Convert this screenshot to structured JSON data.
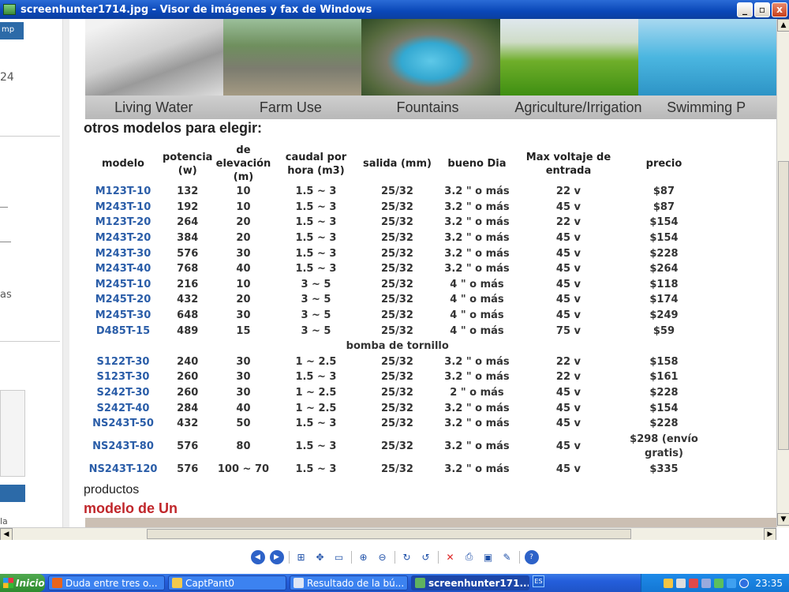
{
  "window": {
    "title": "screenhunter1714.jpg - Visor de imágenes y fax de Windows",
    "minimize": "_",
    "maximize": "▫",
    "close": "x"
  },
  "left_strip": {
    "tab_text": "mp",
    "number": "24",
    "text_as": "as",
    "text_la": "la"
  },
  "banner": {
    "captions": [
      "Living Water",
      "Farm Use",
      "Fountains",
      "Agriculture/Irrigation",
      "Swimming P"
    ]
  },
  "subtitle": "otros modelos para elegir:",
  "table": {
    "headers": [
      [
        "modelo"
      ],
      [
        "potencia",
        "(w)"
      ],
      [
        "de",
        "elevación",
        "(m)"
      ],
      [
        "caudal por",
        "hora (m3)"
      ],
      [
        "salida (mm)"
      ],
      [
        "bueno Dia"
      ],
      [
        "Max voltaje de",
        "entrada"
      ],
      [
        "precio"
      ]
    ],
    "rows": [
      [
        "M123T-10",
        "132",
        "10",
        "1.5 ~ 3",
        "25/32",
        "3.2 \" o más",
        "22 v",
        "$87"
      ],
      [
        "M243T-10",
        "192",
        "10",
        "1.5 ~ 3",
        "25/32",
        "3.2 \" o más",
        "45 v",
        "$87"
      ],
      [
        "M123T-20",
        "264",
        "20",
        "1.5 ~ 3",
        "25/32",
        "3.2 \" o más",
        "22 v",
        "$154"
      ],
      [
        "M243T-20",
        "384",
        "20",
        "1.5 ~ 3",
        "25/32",
        "3.2 \" o más",
        "45 v",
        "$154"
      ],
      [
        "M243T-30",
        "576",
        "30",
        "1.5 ~ 3",
        "25/32",
        "3.2 \" o más",
        "45 v",
        "$228"
      ],
      [
        "M243T-40",
        "768",
        "40",
        "1.5 ~ 3",
        "25/32",
        "3.2 \" o más",
        "45 v",
        "$264"
      ],
      [
        "M245T-10",
        "216",
        "10",
        "3 ~ 5",
        "25/32",
        "4 \" o más",
        "45 v",
        "$118"
      ],
      [
        "M245T-20",
        "432",
        "20",
        "3 ~ 5",
        "25/32",
        "4 \" o más",
        "45 v",
        "$174"
      ],
      [
        "M245T-30",
        "648",
        "30",
        "3 ~ 5",
        "25/32",
        "4 \" o más",
        "45 v",
        "$249"
      ],
      [
        "D485T-15",
        "489",
        "15",
        "3 ~ 5",
        "25/32",
        "4 \" o más",
        "75 v",
        "$59"
      ]
    ],
    "section_label": "bomba de tornillo",
    "rows2": [
      [
        "S122T-30",
        "240",
        "30",
        "1 ~ 2.5",
        "25/32",
        "3.2 \" o más",
        "22 v",
        "$158"
      ],
      [
        "S123T-30",
        "260",
        "30",
        "1.5 ~ 3",
        "25/32",
        "3.2 \" o más",
        "22 v",
        "$161"
      ],
      [
        "S242T-30",
        "260",
        "30",
        "1 ~ 2.5",
        "25/32",
        "2 \" o más",
        "45 v",
        "$228"
      ],
      [
        "S242T-40",
        "284",
        "40",
        "1 ~ 2.5",
        "25/32",
        "3.2 \" o más",
        "45 v",
        "$154"
      ],
      [
        "NS243T-50",
        "432",
        "50",
        "1.5 ~ 3",
        "25/32",
        "3.2 \" o más",
        "45 v",
        "$228"
      ],
      [
        "NS243T-80",
        "576",
        "80",
        "1.5 ~ 3",
        "25/32",
        "3.2 \" o más",
        "45 v",
        "$298 (envío gratis)"
      ],
      [
        "NS243T-120",
        "576",
        "100 ~ 70",
        "1.5 ~ 3",
        "25/32",
        "3.2 \" o más",
        "45 v",
        "$335"
      ]
    ]
  },
  "footer": {
    "productos": "productos",
    "modelo": "modelo de Un"
  },
  "toolbar_icons": [
    "previous-image-icon",
    "next-image-icon",
    "best-fit-icon",
    "actual-size-icon",
    "slideshow-icon",
    "zoom-in-icon",
    "zoom-out-icon",
    "rotate-clockwise-icon",
    "rotate-counterclockwise-icon",
    "delete-icon",
    "print-icon",
    "save-icon",
    "open-editor-icon",
    "help-icon"
  ],
  "taskbar": {
    "start": "Inicio",
    "tasks": [
      {
        "label": "Duda entre tres o...",
        "color": "#e8641c"
      },
      {
        "label": "CaptPant0",
        "color": "#f2c94c"
      },
      {
        "label": "Resultado de la bú...",
        "color": "#dfe7f5"
      },
      {
        "label": "screenhunter171...",
        "color": "#5fb25f",
        "active": true
      }
    ],
    "lang": "ES",
    "clock": "23:35"
  }
}
